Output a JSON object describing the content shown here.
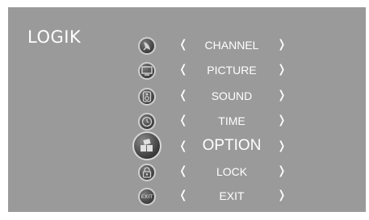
{
  "brand": "LOGIK",
  "menu": {
    "items": [
      {
        "label": "CHANNEL",
        "icon": "satellite-dish-icon",
        "left_arrow": "❬",
        "right_arrow": "❭"
      },
      {
        "label": "PICTURE",
        "icon": "monitor-icon",
        "left_arrow": "❬",
        "right_arrow": "❭"
      },
      {
        "label": "SOUND",
        "icon": "speaker-icon",
        "left_arrow": "❬",
        "right_arrow": "❭"
      },
      {
        "label": "TIME",
        "icon": "clock-icon",
        "left_arrow": "❬",
        "right_arrow": "❭"
      },
      {
        "label": "OPTION",
        "icon": "option-blocks-icon",
        "left_arrow": "❬",
        "right_arrow": "❭",
        "selected": true
      },
      {
        "label": "LOCK",
        "icon": "padlock-icon",
        "left_arrow": "❬",
        "right_arrow": "❭"
      },
      {
        "label": "EXIT",
        "icon": "exit-icon",
        "icon_text": "EXIT",
        "left_arrow": "❬",
        "right_arrow": "❭"
      }
    ]
  },
  "colors": {
    "panel": "#9a9a9a",
    "text": "#ffffff",
    "icon_dark": "#3e3e3e",
    "icon_rim": "#cfcfcf"
  }
}
